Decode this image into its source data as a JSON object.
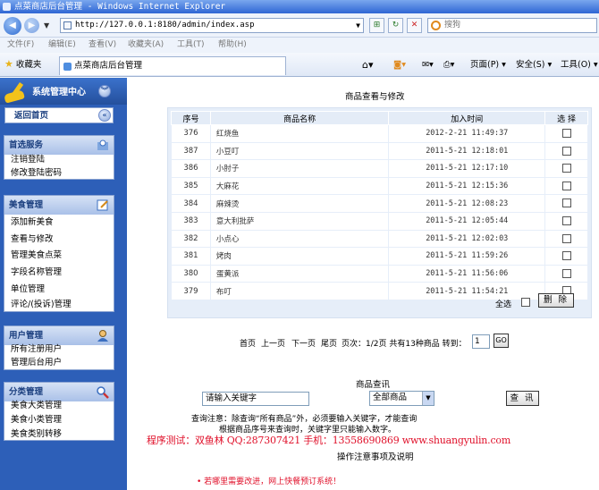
{
  "window": {
    "title": "点菜商店后台管理 - Windows Internet Explorer"
  },
  "browser": {
    "url": "http://127.0.0.1:8180/admin/index.asp",
    "search_placeholder": "搜狗",
    "menu": [
      "文件(F)",
      "编辑(E)",
      "查看(V)",
      "收藏夹(A)",
      "工具(T)",
      "帮助(H)"
    ],
    "favorites_label": "收藏夹",
    "tab_title": "点菜商店后台管理",
    "page_menu": "页面(P)",
    "safety_menu": "安全(S)",
    "tools_menu": "工具(O)"
  },
  "sidebar": {
    "header": "系统管理中心",
    "back_home": "返回首页",
    "sections": [
      {
        "title": "首选服务",
        "items": [
          "注销登陆",
          "修改登陆密码"
        ]
      },
      {
        "title": "美食管理",
        "items": [
          "添加新美食",
          "查看与修改",
          "管理美食点菜",
          "字段名称管理",
          "单位管理",
          "评论/(投诉)管理"
        ]
      },
      {
        "title": "用户管理",
        "items": [
          "所有注册用户",
          "管理后台用户"
        ]
      },
      {
        "title": "分类管理",
        "items": [
          "美食大类管理",
          "美食小类管理",
          "美食类别转移"
        ]
      }
    ]
  },
  "main": {
    "title": "商品查看与修改",
    "columns": [
      "序号",
      "商品名称",
      "加入时间",
      "选 择"
    ],
    "rows": [
      {
        "id": "376",
        "name": "红烧鱼",
        "time": "2012-2-21 11:49:37"
      },
      {
        "id": "387",
        "name": "小豆叮",
        "time": "2011-5-21 12:18:01"
      },
      {
        "id": "386",
        "name": "小肘子",
        "time": "2011-5-21 12:17:10"
      },
      {
        "id": "385",
        "name": "大麻花",
        "time": "2011-5-21 12:15:36"
      },
      {
        "id": "384",
        "name": "麻辣烫",
        "time": "2011-5-21 12:08:23"
      },
      {
        "id": "383",
        "name": "意大利批萨",
        "time": "2011-5-21 12:05:44"
      },
      {
        "id": "382",
        "name": "小点心",
        "time": "2011-5-21 12:02:03"
      },
      {
        "id": "381",
        "name": "烤肉",
        "time": "2011-5-21 11:59:26"
      },
      {
        "id": "380",
        "name": "蛋黄派",
        "time": "2011-5-21 11:56:06"
      },
      {
        "id": "379",
        "name": "布叮",
        "time": "2011-5-21 11:54:21"
      }
    ],
    "select_all": "全选",
    "delete_btn": "删 除",
    "pager": {
      "first": "首页",
      "prev": "上一页",
      "next": "下一页",
      "last": "尾页",
      "info": "页次：1/2页 共有13种商品 转到：",
      "page_value": "1",
      "go": "GO"
    },
    "search": {
      "title": "商品查讯",
      "keyword_value": "请输入关键字",
      "category_value": "全部商品",
      "submit": "查 讯",
      "note1": "查询注意：除查询“所有商品”外，必须要输入关键字，才能查询",
      "note2": "根据商品序号来查询时，关键字里只能输入数字。"
    },
    "test_banner": "程序测试：双鱼林 QQ:287307421 手机：13558690869 www.shuangyulin.com",
    "instructions": "操作注意事项及说明",
    "footer_note": "• 若哪里需要改进，网上快餐预订系统！"
  }
}
